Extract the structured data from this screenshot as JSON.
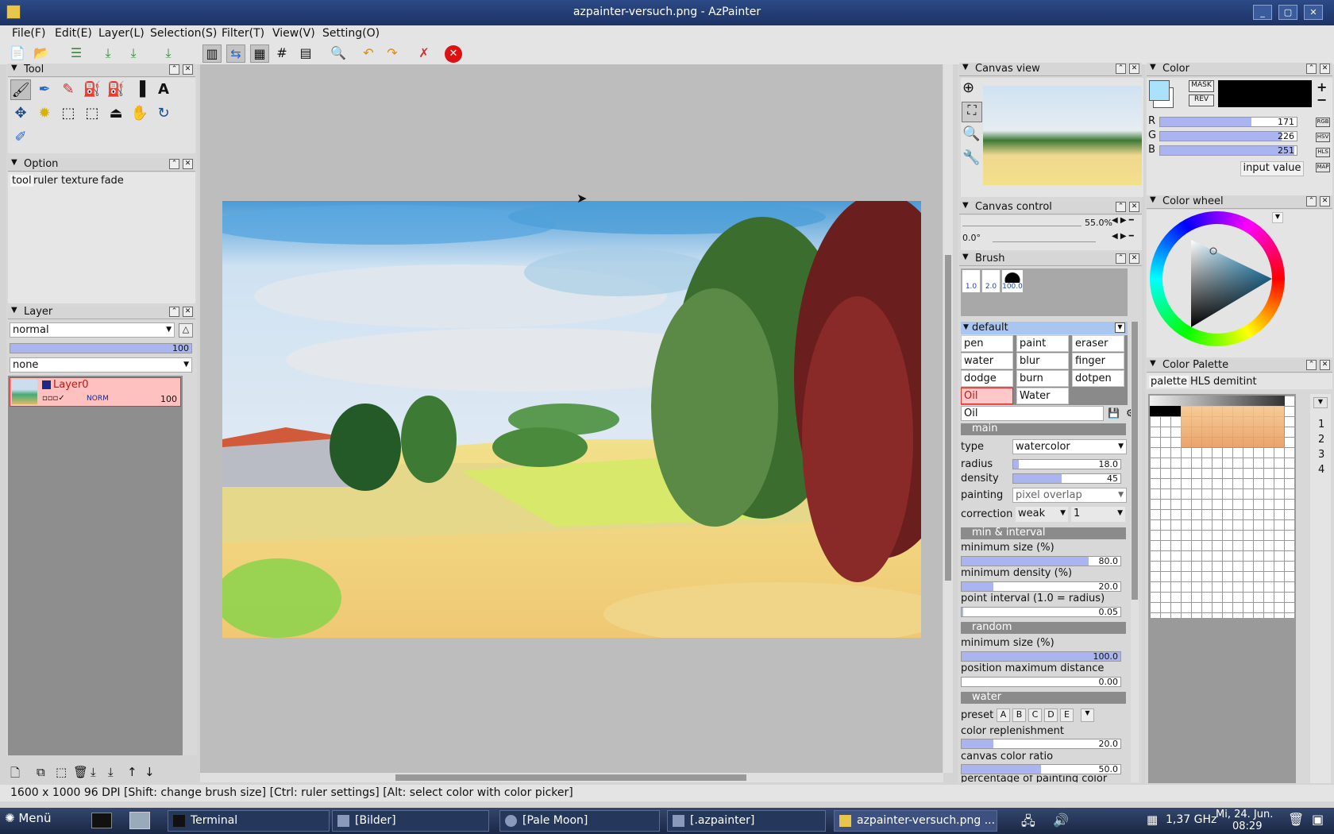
{
  "window": {
    "title": "azpainter-versuch.png - AzPainter"
  },
  "menu": [
    "File(F)",
    "Edit(E)",
    "Layer(L)",
    "Selection(S)",
    "Filter(T)",
    "View(V)",
    "Setting(O)"
  ],
  "panels": {
    "tool": {
      "title": "Tool"
    },
    "option": {
      "title": "Option",
      "tabs": [
        "tool",
        "ruler",
        "texture",
        "fade"
      ]
    },
    "layer": {
      "title": "Layer",
      "blend": "normal",
      "opacity": "100",
      "texture": "none",
      "layer_name": "Layer0",
      "layer_mode": "NORM",
      "layer_opacity": "100"
    },
    "canvas_view": {
      "title": "Canvas view"
    },
    "canvas_control": {
      "title": "Canvas control",
      "zoom": "55.0%",
      "angle": "0.0°"
    },
    "brush": {
      "title": "Brush",
      "sizes": [
        "1.0",
        "2.0",
        "100.0"
      ],
      "group": "default",
      "items": [
        "pen",
        "paint",
        "eraser",
        "water",
        "blur",
        "finger",
        "dodge",
        "burn",
        "dotpen",
        "Oil",
        "Water"
      ],
      "name": "Oil",
      "sections": {
        "main": "main",
        "min": "min & interval",
        "random": "random",
        "water": "water"
      },
      "type_label": "type",
      "type": "watercolor",
      "radius_label": "radius",
      "radius": "18.0",
      "density_label": "density",
      "density": "45",
      "painting_label": "painting",
      "painting": "pixel overlap",
      "correction_label": "correction",
      "correction": "weak",
      "correction_level": "1",
      "min_size_label": "minimum size (%)",
      "min_size": "80.0",
      "min_density_label": "minimum density (%)",
      "min_density": "20.0",
      "interval_label": "point interval (1.0 = radius)",
      "interval": "0.05",
      "rand_min_size_label": "minimum size (%)",
      "rand_min_size": "100.0",
      "pos_max_label": "position maximum distance",
      "pos_max": "0.00",
      "preset_label": "preset",
      "presets": [
        "A",
        "B",
        "C",
        "D",
        "E"
      ],
      "replenish_label": "color replenishment",
      "replenish": "20.0",
      "canvas_ratio_label": "canvas color ratio",
      "canvas_ratio": "50.0",
      "cut_label": "percentage of painting color"
    },
    "color": {
      "title": "Color",
      "mask": "MASK",
      "rev": "REV",
      "r_label": "R",
      "g_label": "G",
      "b_label": "B",
      "r": "171",
      "g": "226",
      "b": "251",
      "input": "input value",
      "modes": [
        "RGB",
        "HSV",
        "HLS",
        "MAP"
      ],
      "fg": "#abe2fb"
    },
    "color_wheel": {
      "title": "Color wheel"
    },
    "color_palette": {
      "title": "Color Palette",
      "tabs": [
        "palette",
        "HLS",
        "demitint"
      ],
      "pages": [
        "1",
        "2",
        "3",
        "4"
      ]
    }
  },
  "status": "1600 x 1000 96 DPI  [Shift: change brush size] [Ctrl: ruler settings] [Alt: select color with color picker]",
  "taskbar": {
    "menu": "Menü",
    "tasks": [
      "Terminal",
      "[Bilder]",
      "[Pale Moon]",
      "[.azpainter]",
      "azpainter-versuch.png ..."
    ],
    "cpu": "1,37 GHz",
    "date": "Mi, 24. Jun.",
    "time": "08:29"
  }
}
